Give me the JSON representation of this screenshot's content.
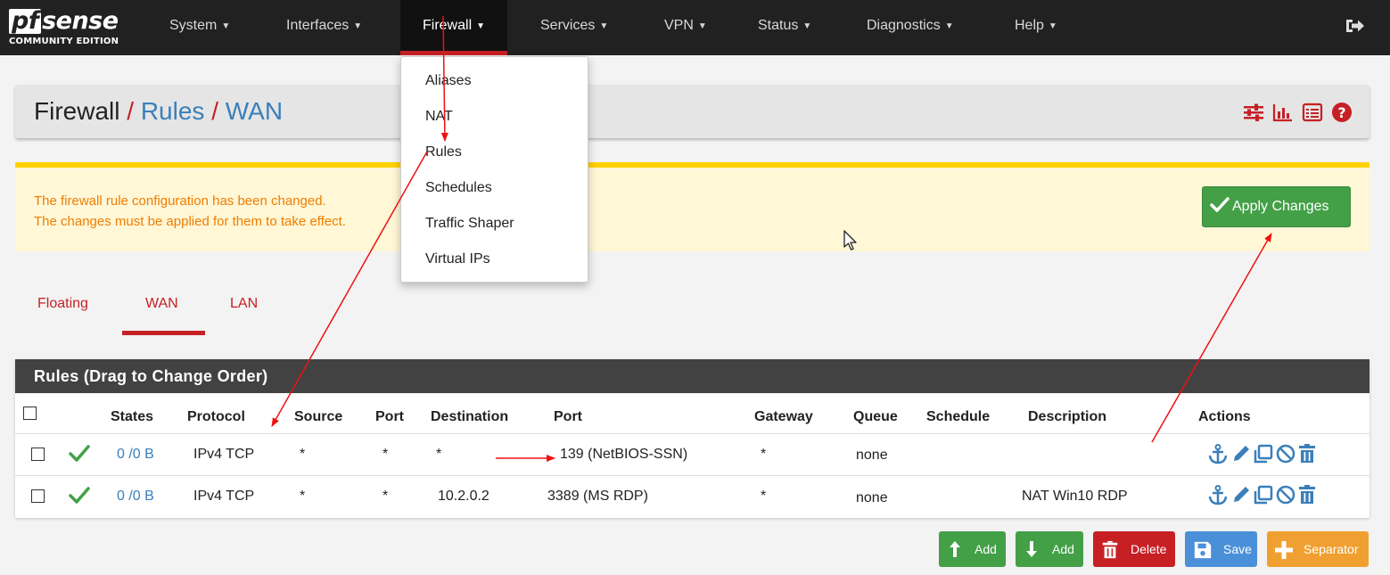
{
  "brand": {
    "main_pf": "pf",
    "main_rest": "sense",
    "sub": "COMMUNITY EDITION"
  },
  "nav": {
    "items": [
      {
        "label": "System"
      },
      {
        "label": "Interfaces"
      },
      {
        "label": "Firewall"
      },
      {
        "label": "Services"
      },
      {
        "label": "VPN"
      },
      {
        "label": "Status"
      },
      {
        "label": "Diagnostics"
      },
      {
        "label": "Help"
      }
    ],
    "active": "Firewall",
    "logout_icon": "sign-out-icon"
  },
  "dropdown": {
    "items": [
      "Aliases",
      "NAT",
      "Rules",
      "Schedules",
      "Traffic Shaper",
      "Virtual IPs"
    ]
  },
  "breadcrumb": {
    "part1": "Firewall",
    "sep": "/",
    "part2": "Rules",
    "part3": "WAN"
  },
  "panel_icons": [
    "sliders-icon",
    "bar-chart-icon",
    "list-icon",
    "question-circle-icon"
  ],
  "alert": {
    "line1": "The firewall rule configuration has been changed.",
    "line2": "The changes must be applied for them to take effect.",
    "apply_label": "Apply Changes"
  },
  "tabs": [
    {
      "label": "Floating"
    },
    {
      "label": "WAN",
      "active": true
    },
    {
      "label": "LAN"
    }
  ],
  "rules": {
    "title": "Rules (Drag to Change Order)",
    "columns": [
      "States",
      "Protocol",
      "Source",
      "Port",
      "Destination",
      "Port",
      "Gateway",
      "Queue",
      "Schedule",
      "Description",
      "Actions"
    ],
    "rows": [
      {
        "states": "0 /0 B",
        "protocol": "IPv4 TCP",
        "source": "*",
        "src_port": "*",
        "destination": "*",
        "dst_port": "139 (NetBIOS-SSN)",
        "gateway": "*",
        "queue": "none",
        "schedule": "",
        "description": ""
      },
      {
        "states": "0 /0 B",
        "protocol": "IPv4 TCP",
        "source": "*",
        "src_port": "*",
        "destination": "10.2.0.2",
        "dst_port": "3389 (MS RDP)",
        "gateway": "*",
        "queue": "none",
        "schedule": "",
        "description": "NAT Win10 RDP"
      }
    ],
    "action_icons": [
      "anchor-icon",
      "pencil-icon",
      "copy-icon",
      "ban-icon",
      "trash-icon"
    ]
  },
  "buttons": {
    "add_top": "Add",
    "add_bottom": "Add",
    "delete": "Delete",
    "save": "Save",
    "separator": "Separator"
  },
  "colors": {
    "navbar": "#212121",
    "accent_red": "#c62025",
    "link_blue": "#3a7fba",
    "success_green": "#43a047",
    "alert_bg": "#fff7d6",
    "alert_border": "#ffd200",
    "alert_text": "#f07d00",
    "save_blue": "#4a90d9",
    "separator_orange": "#f0a030"
  }
}
